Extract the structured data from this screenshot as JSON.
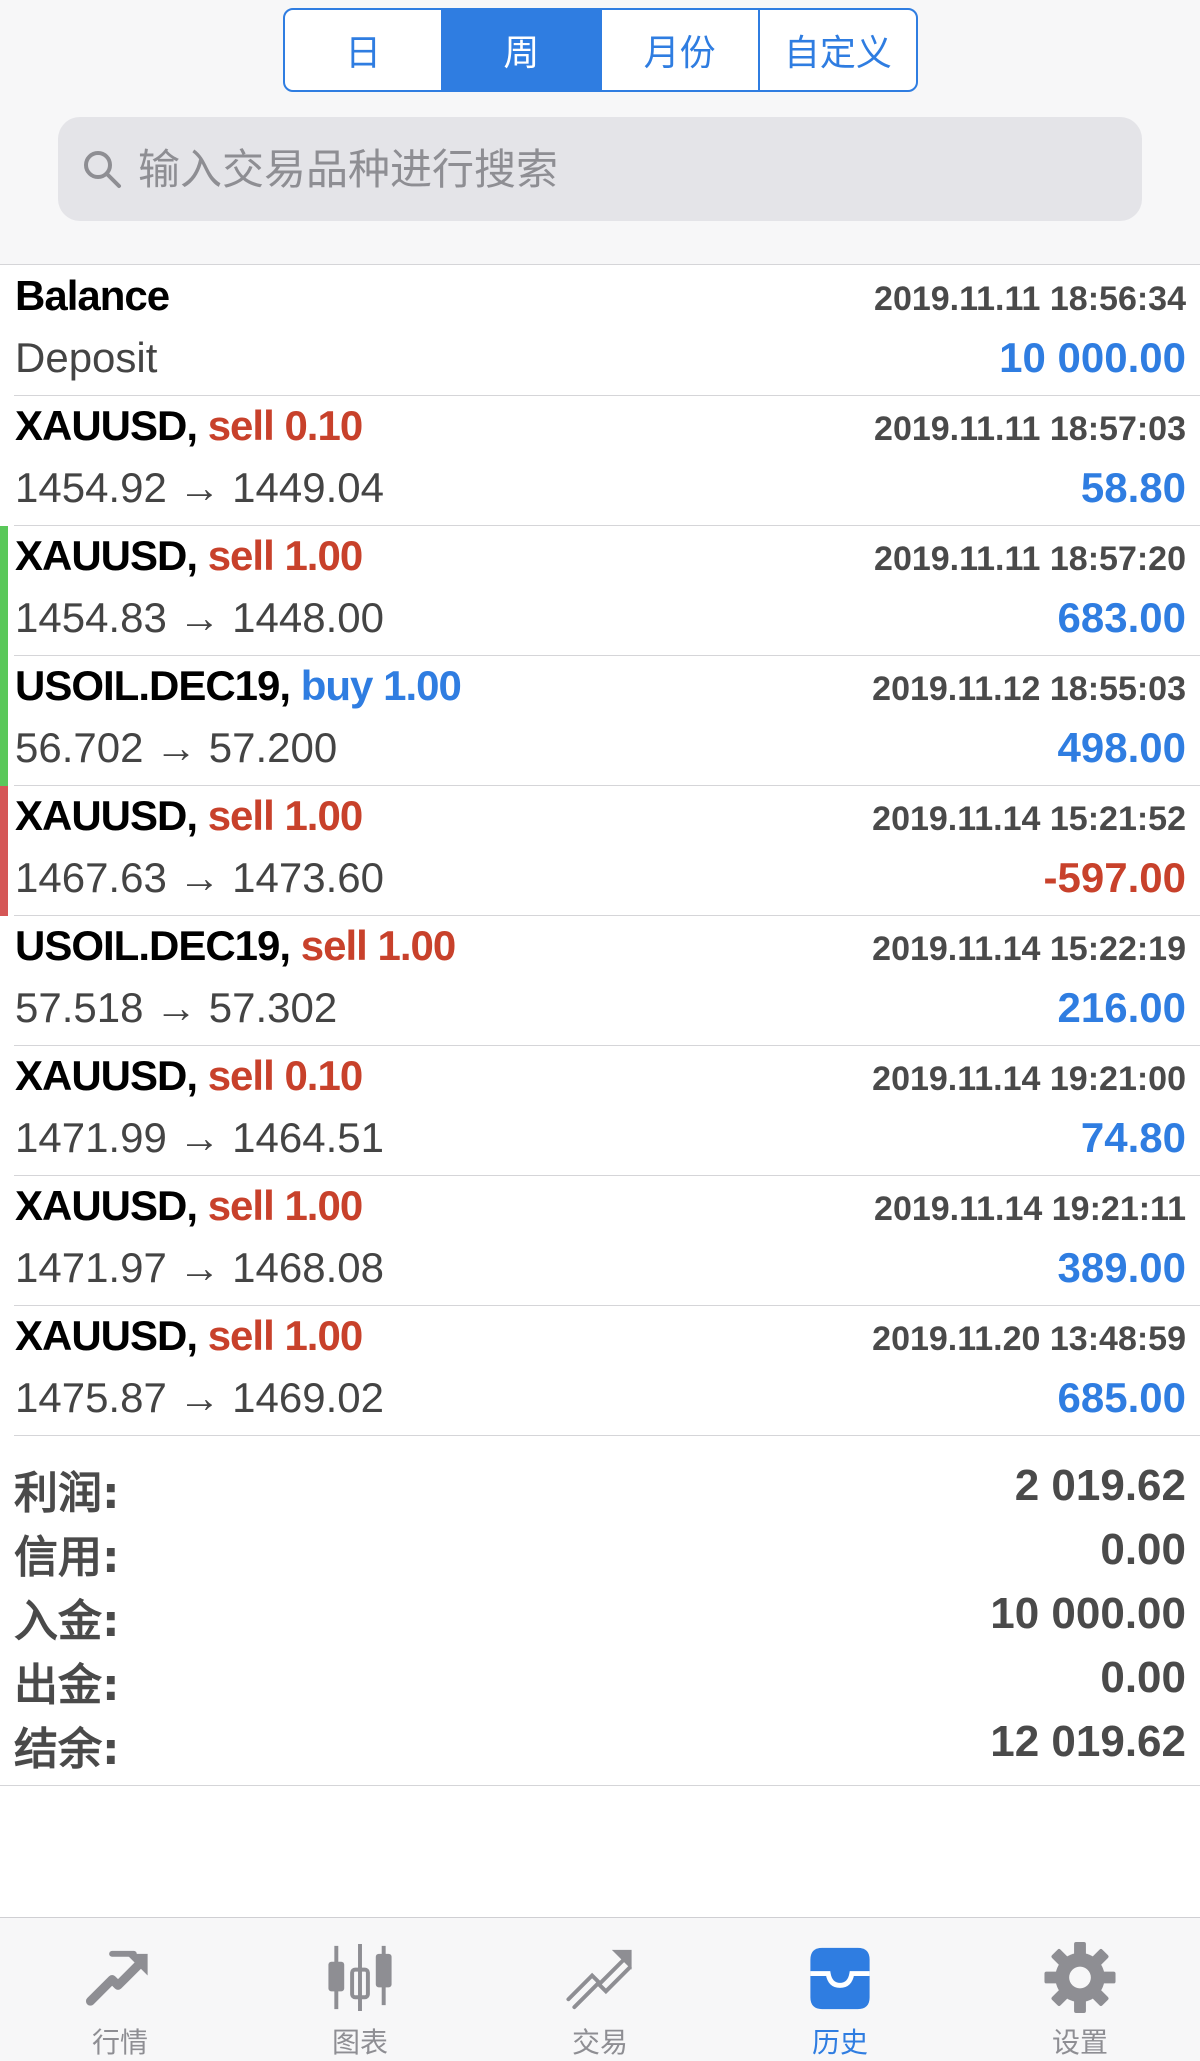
{
  "period_tabs": [
    {
      "label": "日",
      "active": false
    },
    {
      "label": "周",
      "active": true
    },
    {
      "label": "月份",
      "active": false
    },
    {
      "label": "自定义",
      "active": false
    }
  ],
  "search": {
    "placeholder": "输入交易品种进行搜索",
    "value": ""
  },
  "deals": [
    {
      "symbol": "Balance",
      "side": "",
      "volume": "",
      "time": "2019.11.11 18:56:34",
      "detail": "Deposit",
      "amount": "10 000.00",
      "sign": "pos",
      "stripe": "none"
    },
    {
      "symbol": "XAUUSD,",
      "side": "sell",
      "volume": "0.10",
      "time": "2019.11.11 18:57:03",
      "detail": "1454.92 → 1449.04",
      "amount": "58.80",
      "sign": "pos",
      "stripe": "none"
    },
    {
      "symbol": "XAUUSD,",
      "side": "sell",
      "volume": "1.00",
      "time": "2019.11.11 18:57:20",
      "detail": "1454.83 → 1448.00",
      "amount": "683.00",
      "sign": "pos",
      "stripe": "green"
    },
    {
      "symbol": "USOIL.DEC19,",
      "side": "buy",
      "volume": "1.00",
      "time": "2019.11.12 18:55:03",
      "detail": "56.702 → 57.200",
      "amount": "498.00",
      "sign": "pos",
      "stripe": "green"
    },
    {
      "symbol": "XAUUSD,",
      "side": "sell",
      "volume": "1.00",
      "time": "2019.11.14 15:21:52",
      "detail": "1467.63 → 1473.60",
      "amount": "-597.00",
      "sign": "neg",
      "stripe": "red"
    },
    {
      "symbol": "USOIL.DEC19,",
      "side": "sell",
      "volume": "1.00",
      "time": "2019.11.14 15:22:19",
      "detail": "57.518 → 57.302",
      "amount": "216.00",
      "sign": "pos",
      "stripe": "none"
    },
    {
      "symbol": "XAUUSD,",
      "side": "sell",
      "volume": "0.10",
      "time": "2019.11.14 19:21:00",
      "detail": "1471.99 → 1464.51",
      "amount": "74.80",
      "sign": "pos",
      "stripe": "none"
    },
    {
      "symbol": "XAUUSD,",
      "side": "sell",
      "volume": "1.00",
      "time": "2019.11.14 19:21:11",
      "detail": "1471.97 → 1468.08",
      "amount": "389.00",
      "sign": "pos",
      "stripe": "none"
    },
    {
      "symbol": "XAUUSD,",
      "side": "sell",
      "volume": "1.00",
      "time": "2019.11.20 13:48:59",
      "detail": "1475.87 → 1469.02",
      "amount": "685.00",
      "sign": "pos",
      "stripe": "none"
    }
  ],
  "summary": [
    {
      "label": "利润:",
      "value": "2 019.62"
    },
    {
      "label": "信用:",
      "value": "0.00"
    },
    {
      "label": "入金:",
      "value": "10 000.00"
    },
    {
      "label": "出金:",
      "value": "0.00"
    },
    {
      "label": "结余:",
      "value": "12 019.62"
    }
  ],
  "tabbar": [
    {
      "label": "行情",
      "icon": "quotes-icon",
      "active": false
    },
    {
      "label": "图表",
      "icon": "chart-icon",
      "active": false
    },
    {
      "label": "交易",
      "icon": "trade-icon",
      "active": false
    },
    {
      "label": "历史",
      "icon": "history-icon",
      "active": true
    },
    {
      "label": "设置",
      "icon": "settings-icon",
      "active": false
    }
  ],
  "colors": {
    "accent": "#2f7de1",
    "loss": "#c8412b",
    "profit_stripe": "#5ac85a",
    "loss_stripe": "#d55757",
    "inactive": "#8e8e93"
  }
}
